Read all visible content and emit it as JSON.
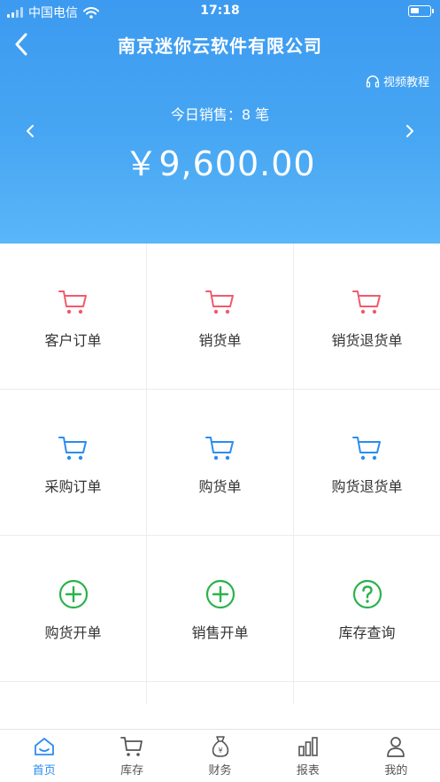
{
  "status_bar": {
    "carrier": "中国电信",
    "time": "17:18"
  },
  "header": {
    "title": "南京迷你云软件有限公司",
    "video_link": "视频教程",
    "sales_label": "今日销售：8 笔",
    "sales_amount": "￥9,600.00"
  },
  "colors": {
    "accent": "#2a8cf0",
    "red": "#f25a6b",
    "blue": "#2a8cf0",
    "green": "#2bb24c"
  },
  "grid": [
    {
      "label": "客户订单",
      "icon": "cart-icon",
      "color": "red"
    },
    {
      "label": "销货单",
      "icon": "cart-icon",
      "color": "red"
    },
    {
      "label": "销货退货单",
      "icon": "cart-icon",
      "color": "red"
    },
    {
      "label": "采购订单",
      "icon": "cart-icon",
      "color": "blue"
    },
    {
      "label": "购货单",
      "icon": "cart-icon",
      "color": "blue"
    },
    {
      "label": "购货退货单",
      "icon": "cart-icon",
      "color": "blue"
    },
    {
      "label": "购货开单",
      "icon": "plus-circle-icon",
      "color": "green"
    },
    {
      "label": "销售开单",
      "icon": "plus-circle-icon",
      "color": "green"
    },
    {
      "label": "库存查询",
      "icon": "question-circle-icon",
      "color": "green"
    }
  ],
  "tabs": [
    {
      "label": "首页",
      "icon": "home-icon",
      "active": true
    },
    {
      "label": "库存",
      "icon": "cart-icon",
      "active": false
    },
    {
      "label": "财务",
      "icon": "money-bag-icon",
      "active": false
    },
    {
      "label": "报表",
      "icon": "bar-chart-icon",
      "active": false
    },
    {
      "label": "我的",
      "icon": "user-icon",
      "active": false
    }
  ]
}
